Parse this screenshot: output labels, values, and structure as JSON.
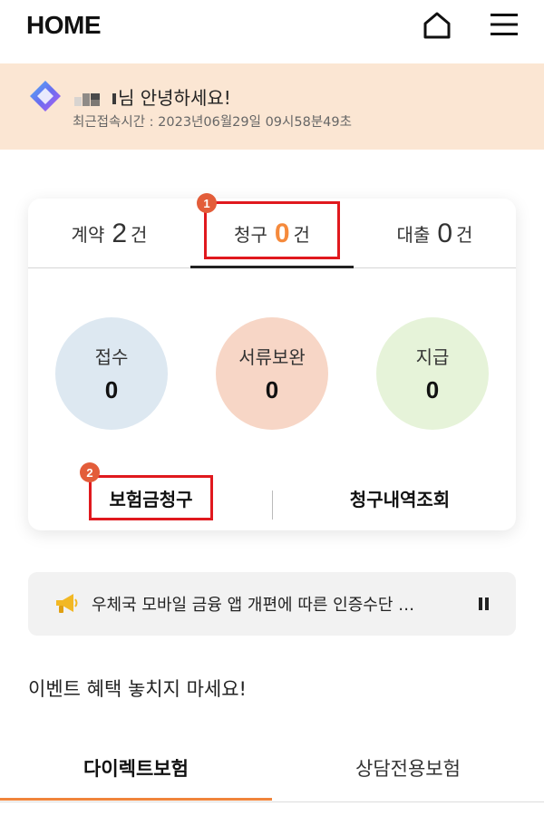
{
  "header": {
    "title": "HOME",
    "home_icon": "home-icon",
    "menu_icon": "menu-icon"
  },
  "greeting": {
    "name_suffix": "님 안녕하세요!",
    "last_login": "최근접속시간 : 2023년06월29일 09시58분49초"
  },
  "tabs": [
    {
      "label": "계약",
      "count": "2",
      "unit": "건"
    },
    {
      "label": "청구",
      "count": "0",
      "unit": "건"
    },
    {
      "label": "대출",
      "count": "0",
      "unit": "건"
    }
  ],
  "stats": [
    {
      "label": "접수",
      "value": "0"
    },
    {
      "label": "서류보완",
      "value": "0"
    },
    {
      "label": "지급",
      "value": "0"
    }
  ],
  "actions": {
    "claim": "보험금청구",
    "history": "청구내역조회"
  },
  "badges": {
    "one": "1",
    "two": "2"
  },
  "notice": {
    "text": "우체국 모바일 금융 앱 개편에 따른 인증수단 …"
  },
  "events": {
    "title": "이벤트 혜택 놓치지 마세요!"
  },
  "bottom_tabs": [
    {
      "label": "다이렉트보험"
    },
    {
      "label": "상담전용보험"
    }
  ],
  "colors": {
    "accent": "#f58a3c",
    "highlight_border": "#e0191e",
    "greeting_bg": "#fbe6d3"
  }
}
